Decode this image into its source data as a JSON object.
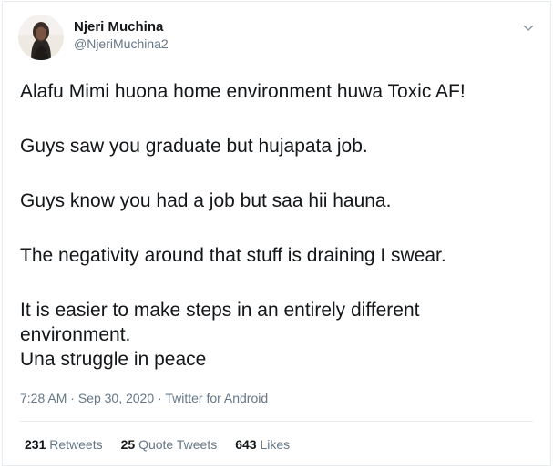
{
  "author": {
    "display_name": "Njeri Muchina",
    "handle": "@NjeriMuchina2"
  },
  "tweet": {
    "paragraphs": [
      [
        "Alafu Mimi huona home environment huwa Toxic AF!"
      ],
      [
        "Guys saw you graduate but hujapata job."
      ],
      [
        "Guys know you had a job but saa hii hauna."
      ],
      [
        "The negativity around that stuff is draining I swear."
      ],
      [
        "It is easier to make steps in an entirely different",
        "environment.",
        "Una struggle in peace"
      ]
    ],
    "time": "7:28 AM",
    "separator": "·",
    "date": "Sep 30, 2020",
    "source": "Twitter for Android"
  },
  "stats": {
    "retweets_count": "231",
    "retweets_label": "Retweets",
    "quotes_count": "25",
    "quotes_label": "Quote Tweets",
    "likes_count": "643",
    "likes_label": "Likes"
  },
  "icons": {
    "caret": "chevron-down-icon"
  },
  "colors": {
    "text": "#14171a",
    "secondary": "#657786",
    "border": "#e6ecf0",
    "caret": "#8899a6"
  }
}
